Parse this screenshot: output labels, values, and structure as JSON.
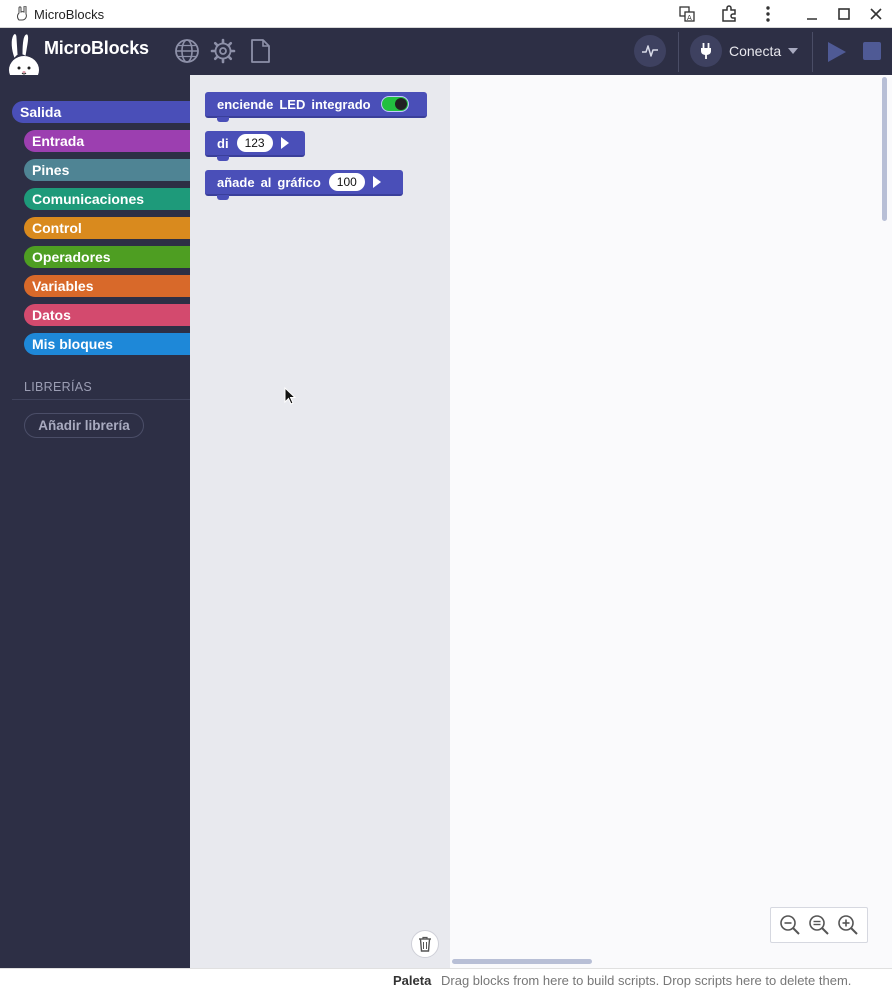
{
  "window": {
    "title": "MicroBlocks",
    "controls": [
      "translate-icon",
      "extensions-icon",
      "menu-icon",
      "minimize-icon",
      "maximize-icon",
      "close-icon"
    ]
  },
  "toolbar": {
    "brand": "MicroBlocks",
    "icons": [
      "globe-icon",
      "gear-icon",
      "file-icon"
    ],
    "graph_icon": "graph-icon",
    "connect_label": "Conecta",
    "plug_icon": "plug-icon",
    "run_icon": "play-icon",
    "stop_icon": "stop-icon"
  },
  "sidebar": {
    "categories": [
      {
        "label": "Salida",
        "color": "#4a4fb8",
        "selected": true
      },
      {
        "label": "Entrada",
        "color": "#9c3fb0"
      },
      {
        "label": "Pines",
        "color": "#4f8494"
      },
      {
        "label": "Comunicaciones",
        "color": "#1e9a7a"
      },
      {
        "label": "Control",
        "color": "#d98a1e"
      },
      {
        "label": "Operadores",
        "color": "#4e9e22"
      },
      {
        "label": "Variables",
        "color": "#d8692a"
      },
      {
        "label": "Datos",
        "color": "#d34a6e"
      },
      {
        "label": "Mis bloques",
        "color": "#1e88d8"
      }
    ],
    "libraries_title": "LIBRERÍAS",
    "add_library_label": "Añadir librería"
  },
  "palette": {
    "blocks": [
      {
        "words": [
          "enciende",
          "LED",
          "integrado"
        ],
        "toggle_on": true
      },
      {
        "words": [
          "di"
        ],
        "slot": "123",
        "has_arrow": true
      },
      {
        "words": [
          "añade",
          "al",
          "gráfico"
        ],
        "slot": "100",
        "has_arrow": true
      }
    ],
    "trash_icon": "trash-icon"
  },
  "scripts": {
    "zoom_icons": [
      "zoom-out-icon",
      "zoom-reset-icon",
      "zoom-in-icon"
    ]
  },
  "status": {
    "title": "Paleta",
    "message": "Drag blocks from here to build scripts. Drop scripts here to delete them."
  }
}
